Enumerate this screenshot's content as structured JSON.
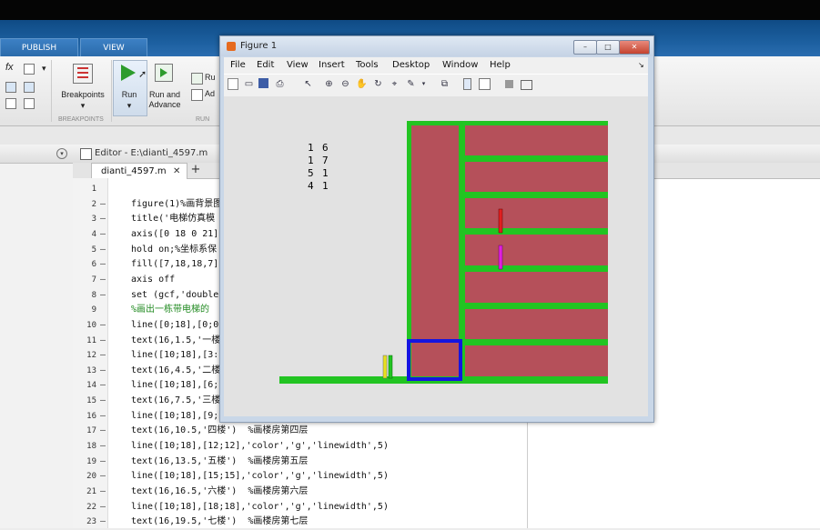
{
  "ribbon": {
    "tabs": [
      "PUBLISH",
      "VIEW"
    ],
    "buttons": {
      "breakpoints": "Breakpoints",
      "run": "Run",
      "run_advance_1": "Run and",
      "run_advance_2": "Advance",
      "run_section": "Ru",
      "advance": "Ad"
    },
    "groups": {
      "breakpoints": "BREAKPOINTS",
      "run": "RUN"
    }
  },
  "editor": {
    "title": "Editor - E:\\dianti_4597.m",
    "tab": "dianti_4597.m",
    "add_tab": "+",
    "lines": [
      {
        "n": "1",
        "dash": "",
        "code": ""
      },
      {
        "n": "2",
        "dash": "–",
        "code": "figure(1)%画背景图"
      },
      {
        "n": "3",
        "dash": "–",
        "code": "title('电梯仿真模"
      },
      {
        "n": "4",
        "dash": "–",
        "code": "axis([0 18 0 21]"
      },
      {
        "n": "5",
        "dash": "–",
        "code": "hold on;%坐标系保"
      },
      {
        "n": "6",
        "dash": "–",
        "code": "fill([7,18,18,7],"
      },
      {
        "n": "7",
        "dash": "–",
        "code": "axis off"
      },
      {
        "n": "8",
        "dash": "–",
        "code": "set (gcf,'double"
      },
      {
        "n": "9",
        "dash": "",
        "code": "%画出一栋带电梯的"
      },
      {
        "n": "10",
        "dash": "–",
        "code": "line([0;18],[0;0"
      },
      {
        "n": "11",
        "dash": "–",
        "code": "text(16,1.5,'一楼"
      },
      {
        "n": "12",
        "dash": "–",
        "code": "line([10;18],[3:"
      },
      {
        "n": "13",
        "dash": "–",
        "code": "text(16,4.5,'二楼"
      },
      {
        "n": "14",
        "dash": "–",
        "code": "line([10;18],[6;"
      },
      {
        "n": "15",
        "dash": "–",
        "code": "text(16,7.5,'三楼"
      },
      {
        "n": "16",
        "dash": "–",
        "code": "line([10;18],[9;"
      },
      {
        "n": "17",
        "dash": "–",
        "code": "text(16,10.5,'四楼')  %画楼房第四层"
      },
      {
        "n": "18",
        "dash": "–",
        "code": "line([10;18],[12;12],'color','g','linewidth',5)"
      },
      {
        "n": "19",
        "dash": "–",
        "code": "text(16,13.5,'五楼')  %画楼房第五层"
      },
      {
        "n": "20",
        "dash": "–",
        "code": "line([10;18],[15;15],'color','g','linewidth',5)"
      },
      {
        "n": "21",
        "dash": "–",
        "code": "text(16,16.5,'六楼')  %画楼房第六层"
      },
      {
        "n": "22",
        "dash": "–",
        "code": "line([10;18],[18;18],'color','g','linewidth',5)"
      },
      {
        "n": "23",
        "dash": "–",
        "code": "text(16,19.5,'七楼')  %画楼房第七层"
      }
    ]
  },
  "figure": {
    "title": "Figure 1",
    "buttons": {
      "minimize": "–",
      "maximize": "□",
      "close": "✕"
    },
    "menu": [
      "File",
      "Edit",
      "View",
      "Insert",
      "Tools",
      "Desktop",
      "Window",
      "Help"
    ],
    "request_pairs": [
      [
        "1",
        "6"
      ],
      [
        "1",
        "7"
      ],
      [
        "5",
        "1"
      ],
      [
        "4",
        "1"
      ]
    ],
    "colors": {
      "building": "#b5505a",
      "floor_line": "#22c422",
      "car_frame": "#1515e0",
      "person_red": "#e02020",
      "person_magenta": "#e020e0",
      "person_yellow": "#e8e020"
    }
  }
}
